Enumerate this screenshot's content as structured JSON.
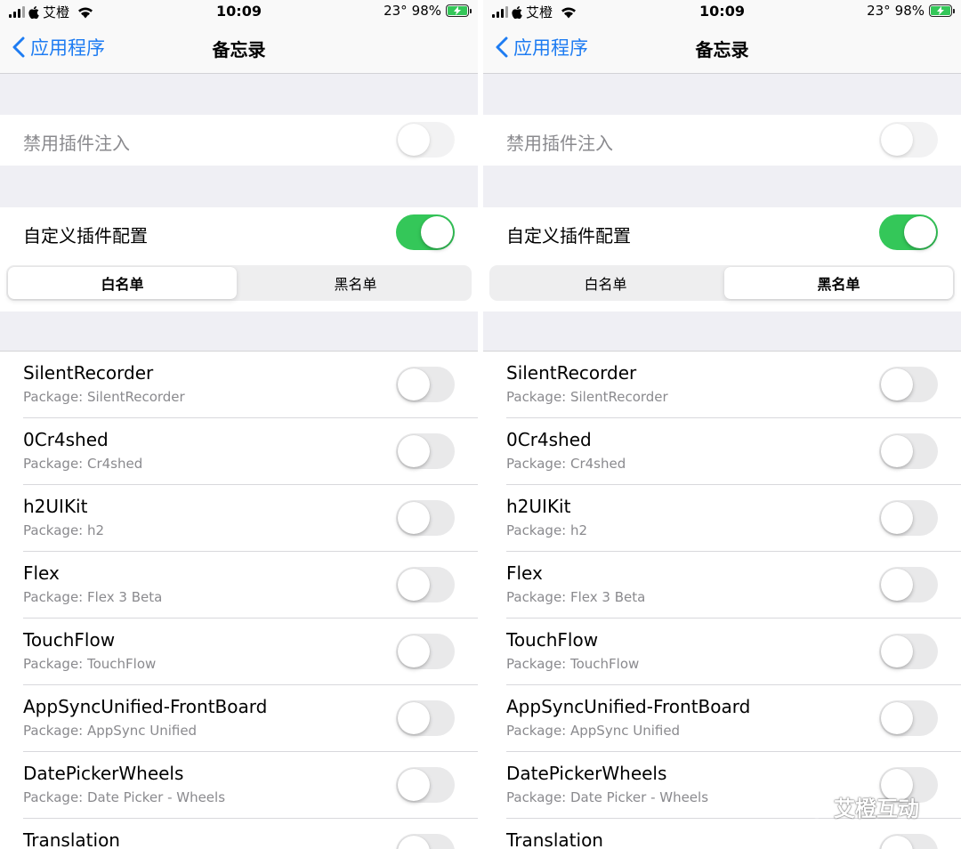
{
  "status": {
    "carrier": "艾橙",
    "time": "10:09",
    "temperature": "23°",
    "battery": "98%"
  },
  "nav": {
    "back_label": "应用程序",
    "title": "备忘录"
  },
  "settings": {
    "disable_injection_label": "禁用插件注入",
    "disable_injection_on": false,
    "custom_config_label": "自定义插件配置",
    "custom_config_on": true
  },
  "segments": [
    "白名单",
    "黑名单"
  ],
  "panels": [
    {
      "selected_segment": 0
    },
    {
      "selected_segment": 1
    }
  ],
  "tweaks": [
    {
      "name": "SilentRecorder",
      "package": "Package: SilentRecorder",
      "enabled": false
    },
    {
      "name": "0Cr4shed",
      "package": "Package: Cr4shed",
      "enabled": false
    },
    {
      "name": "h2UIKit",
      "package": "Package: h2",
      "enabled": false
    },
    {
      "name": "Flex",
      "package": "Package: Flex 3 Beta",
      "enabled": false
    },
    {
      "name": "TouchFlow",
      "package": "Package: TouchFlow",
      "enabled": false
    },
    {
      "name": "AppSyncUnified-FrontBoard",
      "package": "Package: AppSync Unified",
      "enabled": false
    },
    {
      "name": "DatePickerWheels",
      "package": "Package: Date Picker - Wheels",
      "enabled": false
    },
    {
      "name": "Translation",
      "package": "",
      "enabled": false
    }
  ],
  "watermark": "艾橙互动",
  "colors": {
    "accent": "#1e7cf2",
    "switch_on": "#34c759",
    "switch_off": "#e9e9ea"
  },
  "icons": [
    "signal-icon",
    "apple-icon",
    "wifi-icon",
    "battery-charging-icon",
    "chevron-left-icon",
    "wechat-icon"
  ]
}
